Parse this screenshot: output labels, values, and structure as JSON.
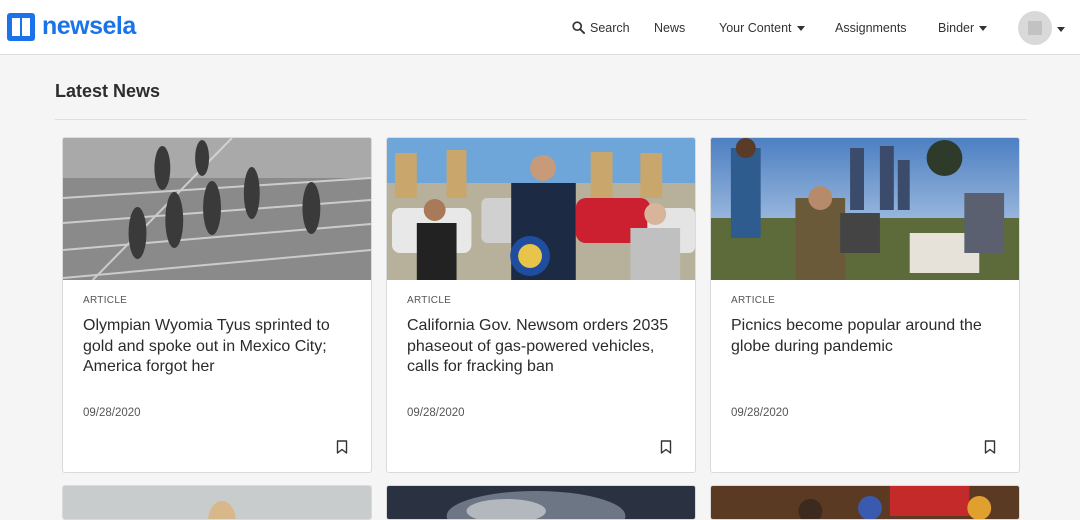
{
  "brand": {
    "name": "newsela"
  },
  "nav": {
    "search_label": "Search",
    "news_label": "News",
    "your_content_label": "Your Content",
    "assignments_label": "Assignments",
    "binder_label": "Binder"
  },
  "section": {
    "title": "Latest News"
  },
  "articles": [
    {
      "kind": "ARTICLE",
      "headline": "Olympian Wyomia Tyus sprinted to gold and spoke out in Mexico City; America forgot her",
      "date": "09/28/2020"
    },
    {
      "kind": "ARTICLE",
      "headline": "California Gov. Newsom orders 2035 phaseout of gas-powered vehicles, calls for fracking ban",
      "date": "09/28/2020"
    },
    {
      "kind": "ARTICLE",
      "headline": "Picnics become popular around the globe during pandemic",
      "date": "09/28/2020"
    }
  ],
  "colors": {
    "brand_blue": "#1a73e8",
    "page_background": "#f5f5f5",
    "card_border": "#dadada"
  }
}
